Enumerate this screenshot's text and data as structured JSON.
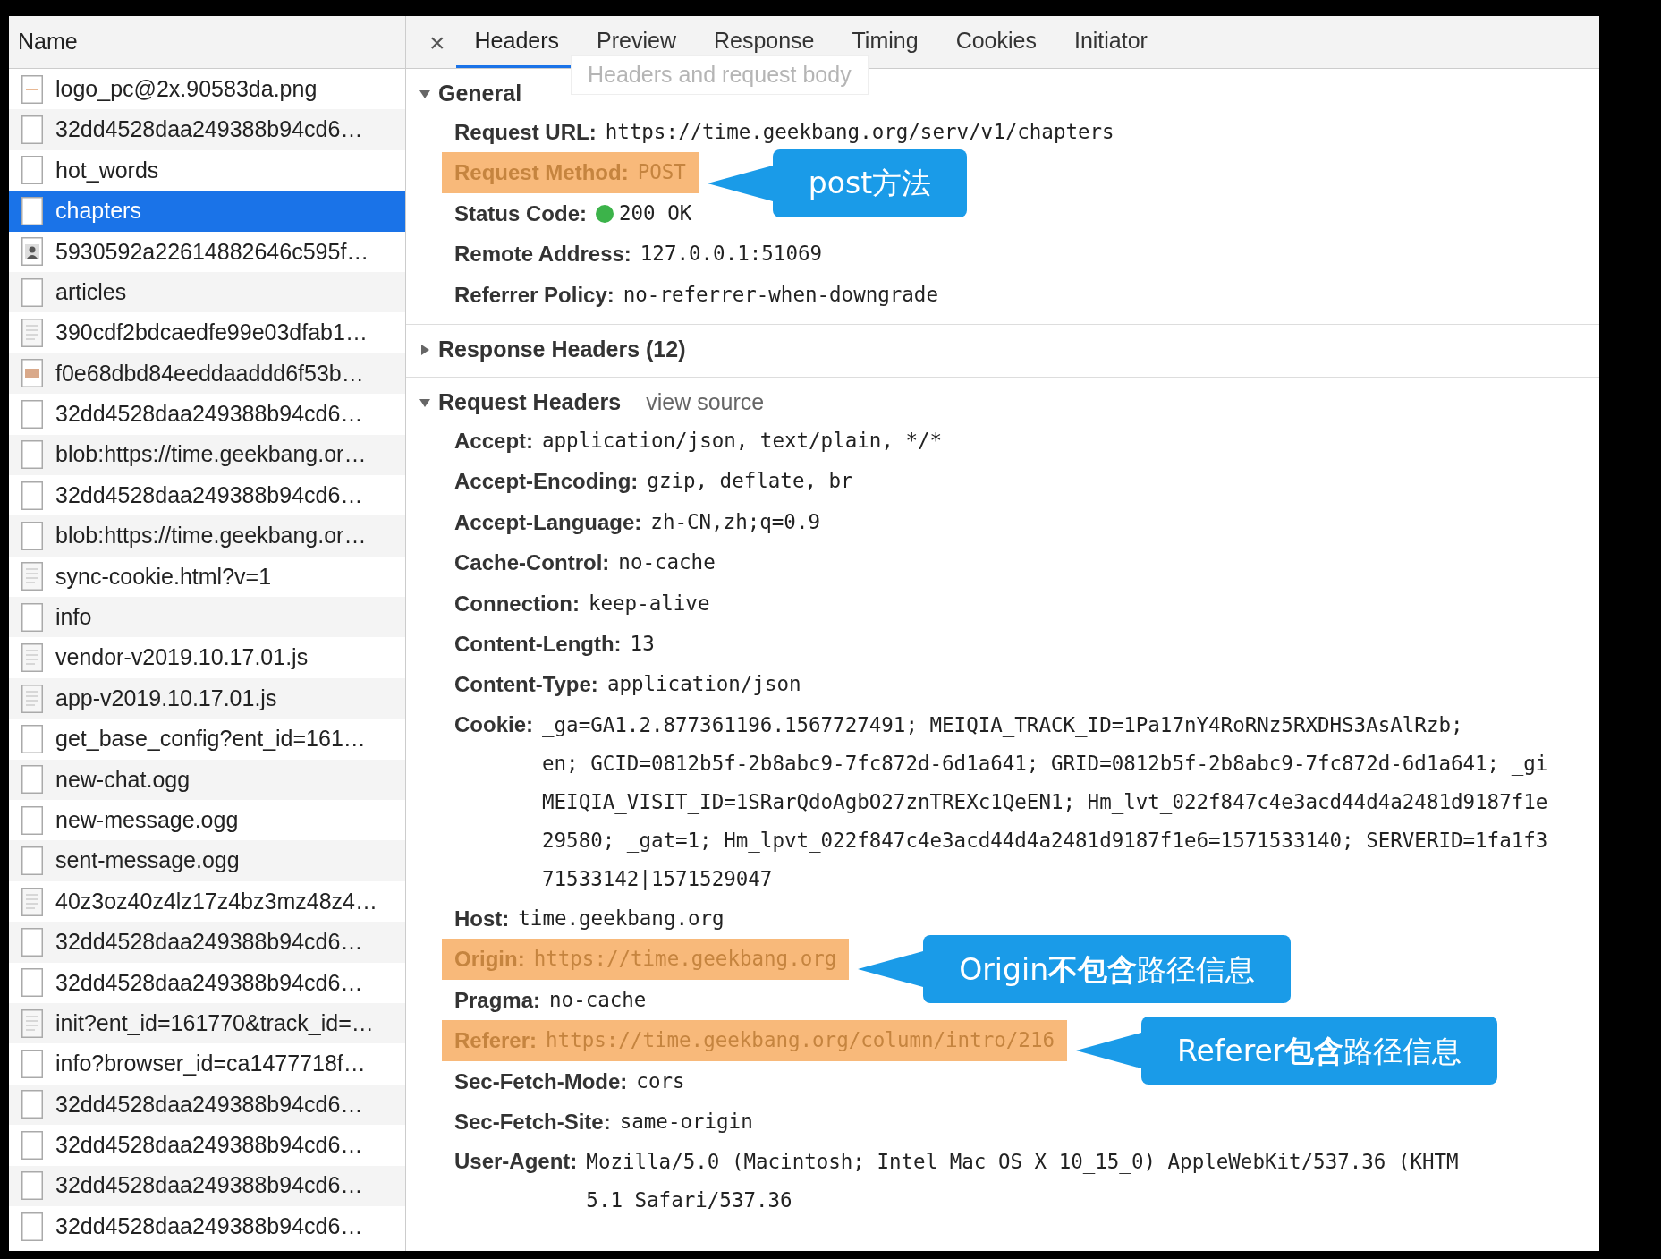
{
  "requests": {
    "column_header": "Name",
    "items": [
      {
        "name": "logo_pc@2x.90583da.png",
        "kind": "image",
        "selected": false
      },
      {
        "name": "32dd4528daa249388b94cd6…",
        "kind": "file",
        "selected": false
      },
      {
        "name": "hot_words",
        "kind": "file",
        "selected": false
      },
      {
        "name": "chapters",
        "kind": "file",
        "selected": true
      },
      {
        "name": "5930592a22614882646c595f…",
        "kind": "photo",
        "selected": false
      },
      {
        "name": "articles",
        "kind": "file",
        "selected": false
      },
      {
        "name": "390cdf2bdcaedfe99e03dfab1…",
        "kind": "script",
        "selected": false
      },
      {
        "name": "f0e68dbd84eeddaaddd6f53b…",
        "kind": "thumbnail",
        "selected": false
      },
      {
        "name": "32dd4528daa249388b94cd6…",
        "kind": "file",
        "selected": false
      },
      {
        "name": "blob:https://time.geekbang.or…",
        "kind": "file",
        "selected": false
      },
      {
        "name": "32dd4528daa249388b94cd6…",
        "kind": "file",
        "selected": false
      },
      {
        "name": "blob:https://time.geekbang.or…",
        "kind": "file",
        "selected": false
      },
      {
        "name": "sync-cookie.html?v=1",
        "kind": "script",
        "selected": false
      },
      {
        "name": "info",
        "kind": "file",
        "selected": false
      },
      {
        "name": "vendor-v2019.10.17.01.js",
        "kind": "script",
        "selected": false
      },
      {
        "name": "app-v2019.10.17.01.js",
        "kind": "script",
        "selected": false
      },
      {
        "name": "get_base_config?ent_id=161…",
        "kind": "file",
        "selected": false
      },
      {
        "name": "new-chat.ogg",
        "kind": "file",
        "selected": false
      },
      {
        "name": "new-message.ogg",
        "kind": "file",
        "selected": false
      },
      {
        "name": "sent-message.ogg",
        "kind": "file",
        "selected": false
      },
      {
        "name": "40z3oz40z4lz17z4bz3mz48z4…",
        "kind": "script",
        "selected": false
      },
      {
        "name": "32dd4528daa249388b94cd6…",
        "kind": "file",
        "selected": false
      },
      {
        "name": "32dd4528daa249388b94cd6…",
        "kind": "file",
        "selected": false
      },
      {
        "name": "init?ent_id=161770&track_id=…",
        "kind": "script",
        "selected": false
      },
      {
        "name": "info?browser_id=ca1477718f…",
        "kind": "file",
        "selected": false
      },
      {
        "name": "32dd4528daa249388b94cd6…",
        "kind": "file",
        "selected": false
      },
      {
        "name": "32dd4528daa249388b94cd6…",
        "kind": "file",
        "selected": false
      },
      {
        "name": "32dd4528daa249388b94cd6…",
        "kind": "file",
        "selected": false
      },
      {
        "name": "32dd4528daa249388b94cd6…",
        "kind": "file",
        "selected": false
      }
    ]
  },
  "details": {
    "close": "×",
    "tabs": [
      {
        "label": "Headers",
        "selected": true
      },
      {
        "label": "Preview",
        "selected": false
      },
      {
        "label": "Response",
        "selected": false
      },
      {
        "label": "Timing",
        "selected": false
      },
      {
        "label": "Cookies",
        "selected": false
      },
      {
        "label": "Initiator",
        "selected": false
      }
    ],
    "tooltip": "Headers and request body",
    "sections": [
      {
        "title": "General",
        "expanded": true,
        "rows": [
          {
            "name": "Request URL:",
            "value": "https://time.geekbang.org/serv/v1/chapters",
            "highlighted": false
          },
          {
            "name": "Request Method:",
            "value": "POST",
            "highlighted": true,
            "callout": "post方法"
          },
          {
            "name": "Status Code:",
            "value": "200 OK",
            "color": "#3cb34a",
            "highlighted": false
          },
          {
            "name": "Remote Address:",
            "value": "127.0.0.1:51069",
            "highlighted": false
          },
          {
            "name": "Referrer Policy:",
            "value": "no-referrer-when-downgrade",
            "highlighted": false
          }
        ]
      },
      {
        "title": "Response Headers (12)",
        "expanded": false
      },
      {
        "title": "Request Headers",
        "link": "view source",
        "expanded": true,
        "rows": [
          {
            "name": "Accept:",
            "value": "application/json, text/plain, */*",
            "highlighted": false
          },
          {
            "name": "Accept-Encoding:",
            "value": "gzip, deflate, br",
            "highlighted": false
          },
          {
            "name": "Accept-Language:",
            "value": "zh-CN,zh;q=0.9",
            "highlighted": false
          },
          {
            "name": "Cache-Control:",
            "value": "no-cache",
            "highlighted": false
          },
          {
            "name": "Connection:",
            "value": "keep-alive",
            "highlighted": false
          },
          {
            "name": "Content-Length:",
            "value": "13",
            "highlighted": false
          },
          {
            "name": "Content-Type:",
            "value": "application/json",
            "highlighted": false
          },
          {
            "name": "Cookie:",
            "value_lines": [
              "_ga=GA1.2.877361196.1567727491; MEIQIA_TRACK_ID=1Pa17nY4RoRNz5RXDHS3AsAlRzb;",
              "en; GCID=0812b5f-2b8abc9-7fc872d-6d1a641; GRID=0812b5f-2b8abc9-7fc872d-6d1a641; _gi",
              "MEIQIA_VISIT_ID=1SRarQdoAgbO27znTREXc1QeEN1; Hm_lvt_022f847c4e3acd44d4a2481d9187f1e",
              "29580; _gat=1; Hm_lpvt_022f847c4e3acd44d4a2481d9187f1e6=1571533140; SERVERID=1fa1f3",
              "71533142|1571529047"
            ],
            "highlighted": false
          },
          {
            "name": "Host:",
            "value": "time.geekbang.org",
            "highlighted": false
          },
          {
            "name": "Origin:",
            "value": "https://time.geekbang.org",
            "highlighted": true,
            "callout": "Origin**不包含**路径信息"
          },
          {
            "name": "Pragma:",
            "value": "no-cache",
            "highlighted": false
          },
          {
            "name": "Referer:",
            "value": "https://time.geekbang.org/column/intro/216",
            "highlighted": true,
            "callout": "Referer**包含**路径信息"
          },
          {
            "name": "Sec-Fetch-Mode:",
            "value": "cors",
            "highlighted": false
          },
          {
            "name": "Sec-Fetch-Site:",
            "value": "same-origin",
            "highlighted": false
          },
          {
            "name": "User-Agent:",
            "value_lines": [
              "Mozilla/5.0 (Macintosh; Intel Mac OS X 10_15_0) AppleWebKit/537.36 (KHTM",
              "5.1 Safari/537.36"
            ],
            "highlighted": false
          }
        ]
      }
    ]
  }
}
